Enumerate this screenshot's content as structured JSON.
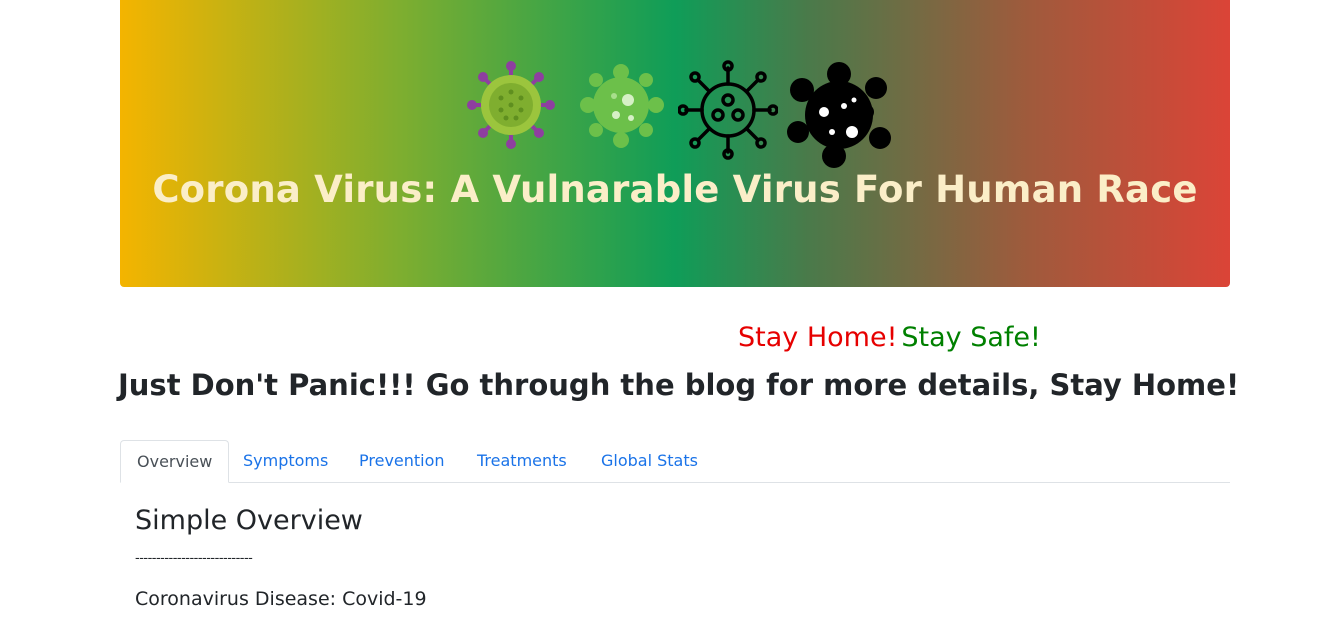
{
  "hero": {
    "title": "Corona Virus: A Vulnarable Virus For Human Race",
    "icons": [
      "virus-purple-icon",
      "virus-green-icon",
      "virus-outline-icon",
      "virus-black-icon"
    ]
  },
  "banner": {
    "stay_home": "Stay Home!",
    "stay_safe": "Stay Safe!"
  },
  "headline": "Just Don't Panic!!! Go through the blog for more details, Stay Home!",
  "tabs": [
    {
      "label": "Overview",
      "active": true
    },
    {
      "label": "Symptoms",
      "active": false
    },
    {
      "label": "Prevention",
      "active": false
    },
    {
      "label": "Treatments",
      "active": false
    },
    {
      "label": "Global Stats",
      "active": false
    }
  ],
  "content": {
    "title": "Simple Overview",
    "divider": "----------------------------",
    "subheading": "Coronavirus Disease: Covid-19"
  },
  "colors": {
    "stay_home": "#e60000",
    "stay_safe": "#008000",
    "tab_link": "#1a73e8",
    "hero_title": "#fbeec8"
  }
}
